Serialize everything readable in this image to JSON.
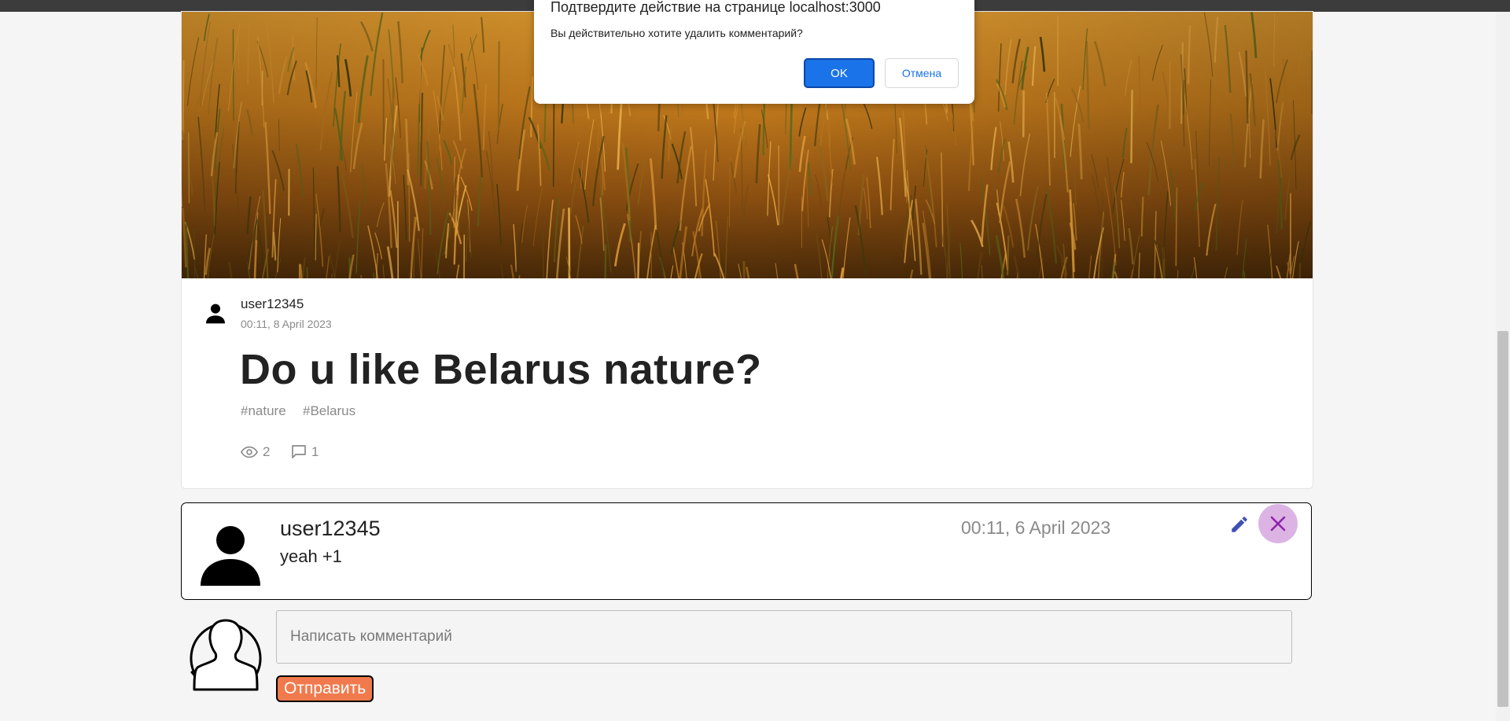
{
  "colors": {
    "accent_blue": "#1a73e8",
    "submit_orange": "#f07a4d",
    "delete_bg": "#dcb4e4",
    "delete_icon": "#8e24aa",
    "edit_icon": "#3f51b5",
    "muted_text": "#8a8a8a"
  },
  "dialog": {
    "title": "Подтвердите действие на странице localhost:3000",
    "message": "Вы действительно хотите удалить комментарий?",
    "ok_label": "OK",
    "cancel_label": "Отмена"
  },
  "post": {
    "image_icon": "wheat-field-photo",
    "author": "user12345",
    "date": "00:11, 8 April 2023",
    "title": "Do u like Belarus nature?",
    "tags": [
      "#nature",
      "#Belarus"
    ],
    "views": "2",
    "comments_count": "1",
    "views_icon": "eye-icon",
    "comments_icon": "comment-icon"
  },
  "comment": {
    "author": "user12345",
    "text": "yeah +1",
    "date": "00:11, 6 April 2023",
    "edit_icon": "pencil-icon",
    "delete_icon": "close-icon"
  },
  "new_comment": {
    "placeholder": "Написать комментарий",
    "submit_label": "Отправить",
    "avatar_icon": "user-outline-icon"
  }
}
